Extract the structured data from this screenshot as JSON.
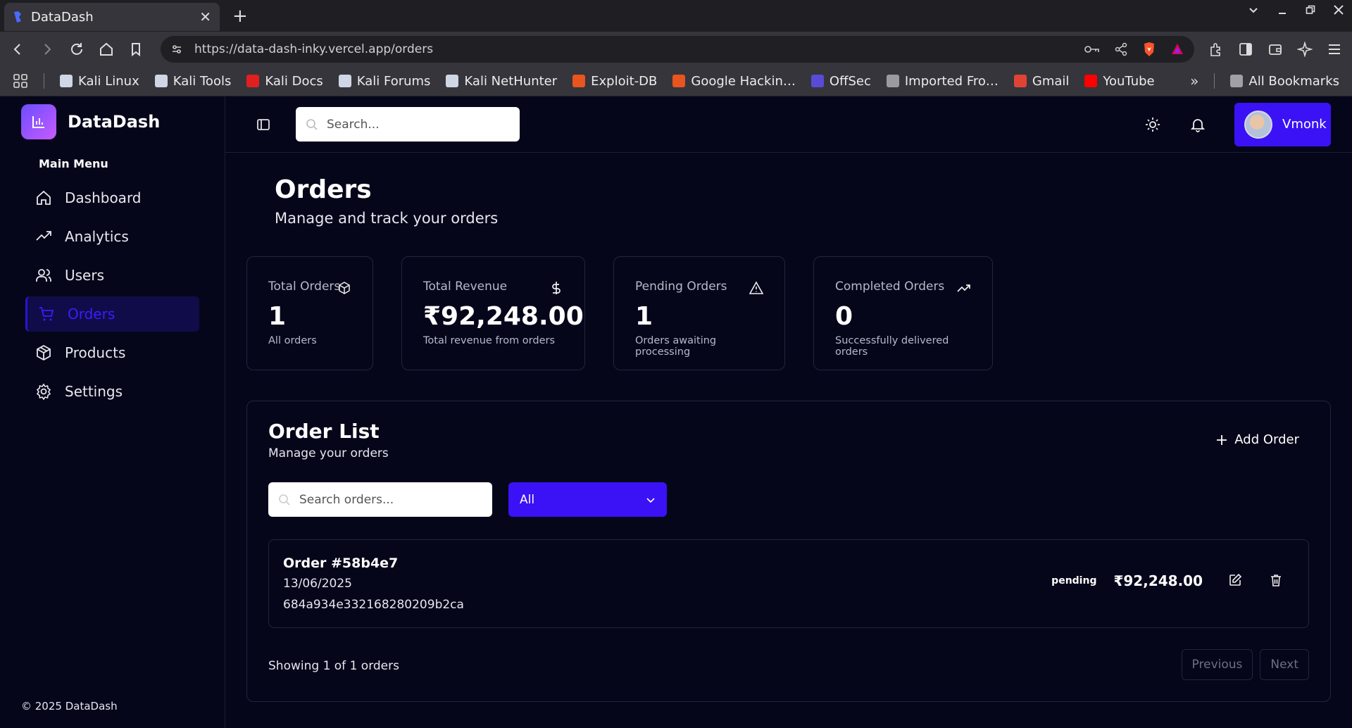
{
  "browser": {
    "tab_title": "DataDash",
    "url": "https://data-dash-inky.vercel.app/orders",
    "bookmarks": [
      {
        "label": "Kali Linux",
        "icon": "kali-dragon-icon",
        "color": "#cfd6e6"
      },
      {
        "label": "Kali Tools",
        "icon": "kali-dragon-icon",
        "color": "#cfd6e6"
      },
      {
        "label": "Kali Docs",
        "icon": "kali-docs-icon",
        "color": "#e02020"
      },
      {
        "label": "Kali Forums",
        "icon": "kali-forums-icon",
        "color": "#cfd6e6"
      },
      {
        "label": "Kali NetHunter",
        "icon": "kali-dragon-icon",
        "color": "#cfd6e6"
      },
      {
        "label": "Exploit-DB",
        "icon": "exploit-db-icon",
        "color": "#e8551e"
      },
      {
        "label": "Google Hackin…",
        "icon": "exploit-db-icon",
        "color": "#e8551e"
      },
      {
        "label": "OffSec",
        "icon": "offsec-icon",
        "color": "#5a4bd6"
      },
      {
        "label": "Imported Fro…",
        "icon": "folder-icon",
        "color": "#9a9aa0"
      },
      {
        "label": "Gmail",
        "icon": "gmail-icon",
        "color": "#e04336"
      },
      {
        "label": "YouTube",
        "icon": "youtube-icon",
        "color": "#f00"
      }
    ],
    "all_bookmarks": "All Bookmarks"
  },
  "sidebar": {
    "brand": "DataDash",
    "menu_title": "Main Menu",
    "items": [
      {
        "label": "Dashboard",
        "icon": "home-icon"
      },
      {
        "label": "Analytics",
        "icon": "trending-up-icon"
      },
      {
        "label": "Users",
        "icon": "users-icon"
      },
      {
        "label": "Orders",
        "icon": "cart-icon",
        "active": true
      },
      {
        "label": "Products",
        "icon": "box-icon"
      },
      {
        "label": "Settings",
        "icon": "gear-icon"
      }
    ],
    "copyright": "© 2025 DataDash"
  },
  "topbar": {
    "search_placeholder": "Search...",
    "user_name": "Vmonk"
  },
  "page": {
    "title": "Orders",
    "subtitle": "Manage and track your orders"
  },
  "stats": [
    {
      "label": "Total Orders",
      "value": "1",
      "sub": "All orders",
      "icon": "box-icon"
    },
    {
      "label": "Total Revenue",
      "value": "₹92,248.00",
      "sub": "Total revenue from orders",
      "icon": "dollar-icon"
    },
    {
      "label": "Pending Orders",
      "value": "1",
      "sub": "Orders awaiting processing",
      "icon": "alert-triangle-icon"
    },
    {
      "label": "Completed Orders",
      "value": "0",
      "sub": "Successfully delivered orders",
      "icon": "trending-up-icon"
    }
  ],
  "order_list": {
    "title": "Order List",
    "subtitle": "Manage your orders",
    "add_label": "Add Order",
    "search_placeholder": "Search orders...",
    "filter_value": "All",
    "orders": [
      {
        "id": "Order #58b4e7",
        "date": "13/06/2025",
        "hash": "684a934e332168280209b2ca",
        "status": "pending",
        "amount": "₹92,248.00"
      }
    ],
    "showing": "Showing 1 of 1 orders",
    "previous": "Previous",
    "next": "Next"
  },
  "colors": {
    "accent": "#3a12f5",
    "background": "#05061a"
  }
}
